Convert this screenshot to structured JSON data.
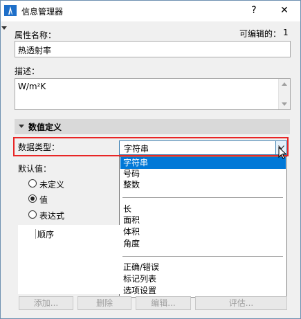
{
  "window": {
    "title": "信息管理器",
    "help_label": "?",
    "close_label": "✕"
  },
  "property": {
    "name_label": "属性名称：",
    "editable_label": "可编辑的：",
    "editable_value": "1",
    "name_value": "热透射率",
    "desc_label": "描述：",
    "desc_value": "W/m²K"
  },
  "section": {
    "title": "数值定义"
  },
  "datatype": {
    "label": "数据类型：",
    "selected": "字符串",
    "options_group1": [
      "字符串",
      "号码",
      "整数"
    ],
    "options_group2": [
      "长",
      "面积",
      "体积",
      "角度"
    ],
    "options_group3": [
      "正确/错误",
      "标记列表",
      "选项设置"
    ]
  },
  "default": {
    "label": "默认值：",
    "radios": [
      "未定义",
      "值",
      "表达式"
    ],
    "checked_index": 1
  },
  "list": {
    "column_label": "顺序"
  },
  "buttons": {
    "add": "添加...",
    "delete": "删除",
    "edit": "编辑...",
    "evaluate": "评估..."
  },
  "colors": {
    "highlight_border": "#e82626",
    "selected_option_bg": "#0078d7",
    "combo_border": "#3c7fb1"
  },
  "icons": {
    "app": "archicad-icon",
    "dropdown": "chevron-down-icon",
    "cursor": "mouse-pointer-icon"
  }
}
